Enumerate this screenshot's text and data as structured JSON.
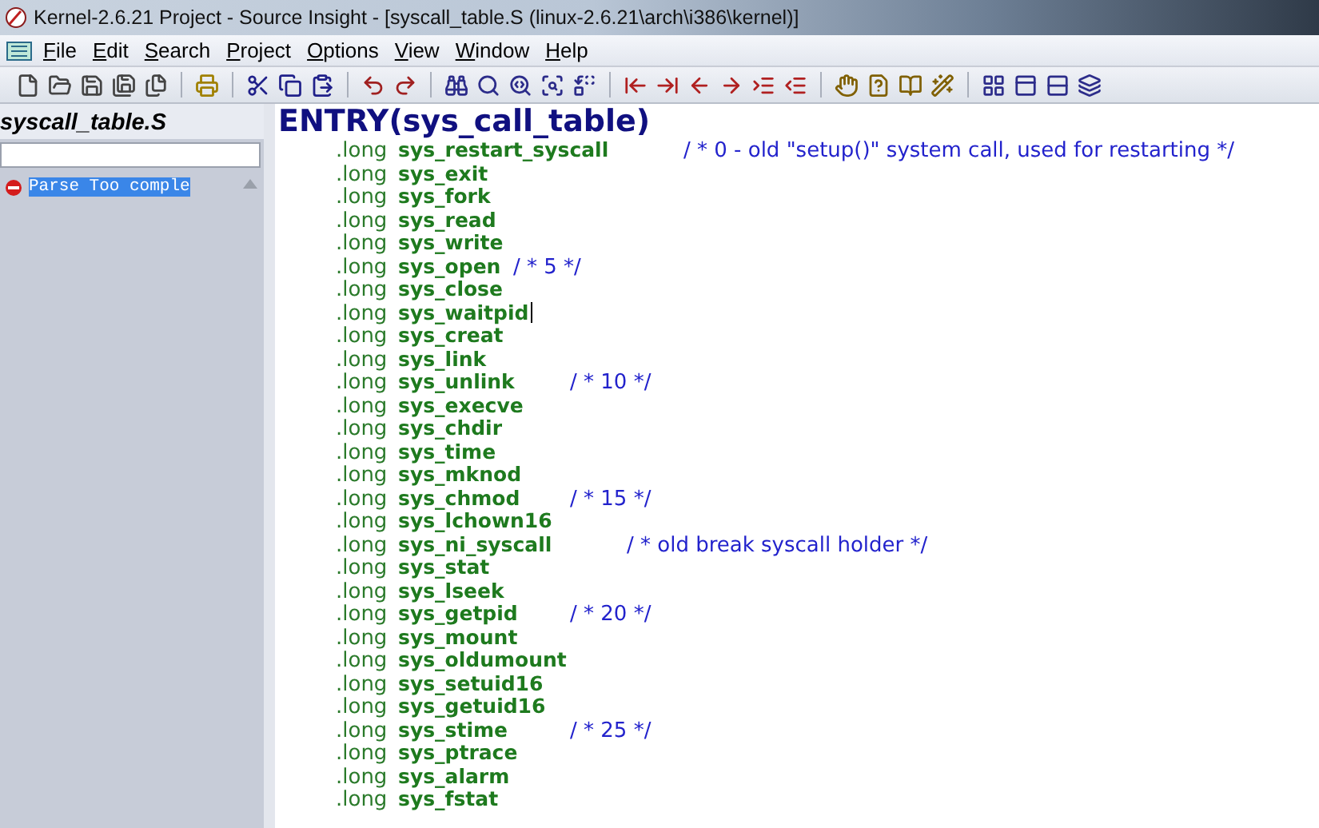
{
  "window": {
    "title": "Kernel-2.6.21 Project - Source Insight - [syscall_table.S (linux-2.6.21\\arch\\i386\\kernel)]"
  },
  "menu": [
    "File",
    "Edit",
    "Search",
    "Project",
    "Options",
    "View",
    "Window",
    "Help"
  ],
  "sidebar": {
    "title": "syscall_table.S",
    "items": [
      {
        "label": "Parse Too comple",
        "selected": true
      }
    ]
  },
  "editor": {
    "heading": "ENTRY(sys_call_table)",
    "lines": [
      {
        "directive": ".long",
        "symbol": "sys_restart_syscall",
        "comment": "/ * 0 -  old \"setup()\" system call, used for restarting */",
        "caret": false
      },
      {
        "directive": ".long",
        "symbol": "sys_exit",
        "caret": false
      },
      {
        "directive": ".long",
        "symbol": "sys_fork",
        "caret": false
      },
      {
        "directive": ".long",
        "symbol": "sys_read",
        "caret": false
      },
      {
        "directive": ".long",
        "symbol": "sys_write",
        "caret": false
      },
      {
        "directive": ".long",
        "symbol": "sys_open",
        "comment": "/ * 5 */",
        "caret": false
      },
      {
        "directive": ".long",
        "symbol": "sys_close",
        "caret": false
      },
      {
        "directive": ".long",
        "symbol": "sys_waitpid",
        "caret": true
      },
      {
        "directive": ".long",
        "symbol": "sys_creat",
        "caret": false
      },
      {
        "directive": ".long",
        "symbol": "sys_link",
        "caret": false
      },
      {
        "directive": ".long",
        "symbol": "sys_unlink",
        "comment": "/ * 10 */",
        "caret": false
      },
      {
        "directive": ".long",
        "symbol": "sys_execve",
        "caret": false
      },
      {
        "directive": ".long",
        "symbol": "sys_chdir",
        "caret": false
      },
      {
        "directive": ".long",
        "symbol": "sys_time",
        "caret": false
      },
      {
        "directive": ".long",
        "symbol": "sys_mknod",
        "caret": false
      },
      {
        "directive": ".long",
        "symbol": "sys_chmod",
        "comment": "/ * 15 */",
        "caret": false
      },
      {
        "directive": ".long",
        "symbol": "sys_lchown16",
        "caret": false
      },
      {
        "directive": ".long",
        "symbol": "sys_ni_syscall",
        "comment": "/ * old break syscall holder */",
        "caret": false
      },
      {
        "directive": ".long",
        "symbol": "sys_stat",
        "caret": false
      },
      {
        "directive": ".long",
        "symbol": "sys_lseek",
        "caret": false
      },
      {
        "directive": ".long",
        "symbol": "sys_getpid",
        "comment": "/ * 20 */",
        "caret": false
      },
      {
        "directive": ".long",
        "symbol": "sys_mount",
        "caret": false
      },
      {
        "directive": ".long",
        "symbol": "sys_oldumount",
        "caret": false
      },
      {
        "directive": ".long",
        "symbol": "sys_setuid16",
        "caret": false
      },
      {
        "directive": ".long",
        "symbol": "sys_getuid16",
        "caret": false
      },
      {
        "directive": ".long",
        "symbol": "sys_stime",
        "comment": "/ * 25 */",
        "caret": false
      },
      {
        "directive": ".long",
        "symbol": "sys_ptrace",
        "caret": false
      },
      {
        "directive": ".long",
        "symbol": "sys_alarm",
        "caret": false
      },
      {
        "directive": ".long",
        "symbol": "sys_fstat",
        "caret": false
      }
    ]
  }
}
